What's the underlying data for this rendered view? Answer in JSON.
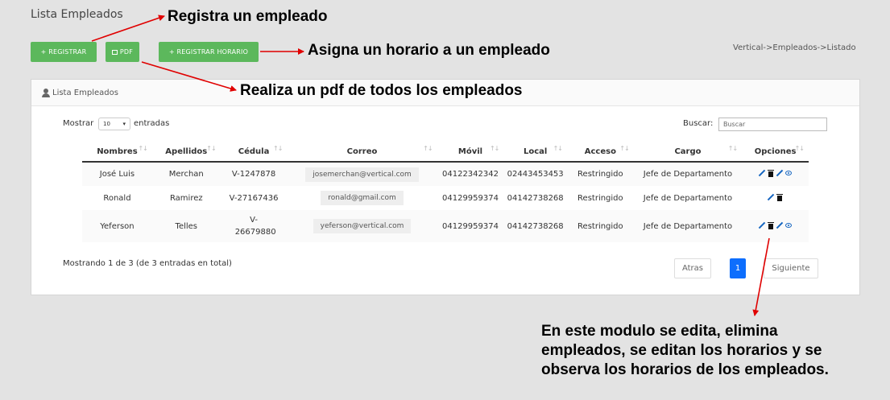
{
  "page": {
    "title": "Lista Empleados",
    "breadcrumb": "Vertical->Empleados->Listado"
  },
  "toolbar": {
    "register_label": "+ REGISTRAR",
    "pdf_label": "PDF",
    "register_schedule_label": "+ REGISTRAR HORARIO"
  },
  "panel": {
    "title": "Lista Empleados"
  },
  "length": {
    "prefix": "Mostrar",
    "value": "10",
    "suffix": "entradas"
  },
  "search": {
    "label": "Buscar:",
    "placeholder": "Buscar"
  },
  "table": {
    "headers": [
      "Nombres",
      "Apellidos",
      "Cédula",
      "Correo",
      "Móvil",
      "Local",
      "Acceso",
      "Cargo",
      "Opciones"
    ],
    "rows": [
      {
        "nombres": "José Luis",
        "apellidos": "Merchan",
        "cedula": "V-1247878",
        "correo": "josemerchan@vertical.com",
        "movil": "04122342342",
        "local": "02443453453",
        "acceso": "Restringido",
        "cargo": "Jefe de Departamento"
      },
      {
        "nombres": "Ronald",
        "apellidos": "Ramirez",
        "cedula": "V-27167436",
        "correo": "ronald@gmail.com",
        "movil": "04129959374",
        "local": "04142738268",
        "acceso": "Restringido",
        "cargo": "Jefe de Departamento"
      },
      {
        "nombres": "Yeferson",
        "apellidos": "Telles",
        "cedula": "V-26679880",
        "correo": "yeferson@vertical.com",
        "movil": "04129959374",
        "local": "04142738268",
        "acceso": "Restringido",
        "cargo": "Jefe de Departamento"
      }
    ]
  },
  "pagination": {
    "info": "Mostrando 1 de 3 (de 3 entradas en total)",
    "prev": "Atras",
    "current": "1",
    "next": "Siguiente"
  },
  "annotations": {
    "register": "Registra un empleado",
    "schedule": "Asigna un horario a un empleado",
    "pdf": "Realiza un pdf de todos los empleados",
    "options": [
      "En este modulo se edita, elimina",
      "empleados, se editan los horarios y se",
      "observa los horarios de los empleados."
    ]
  },
  "colors": {
    "accent_green": "#5cb85c",
    "access_green": "#2e8b57",
    "arrow_red": "#e00000",
    "pagination_blue": "#0d6efd"
  },
  "icons": [
    "user-icon",
    "pdf-icon",
    "chevron-updown-icon",
    "sort-icon",
    "edit-icon",
    "delete-icon",
    "schedule-edit-icon",
    "view-icon"
  ]
}
